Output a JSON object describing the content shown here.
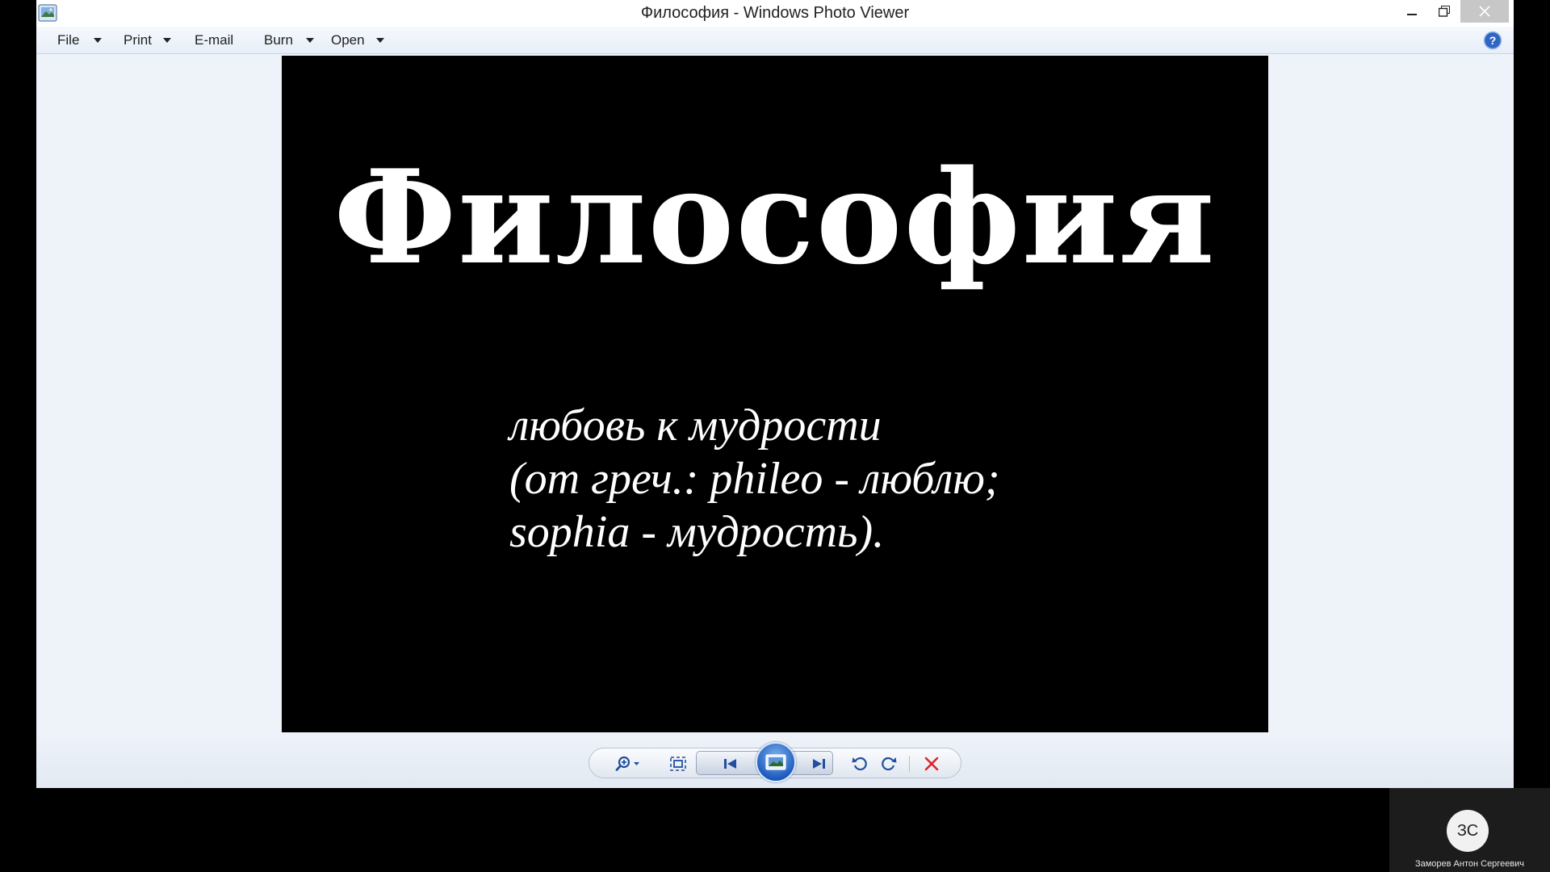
{
  "window": {
    "title": "Философия - Windows Photo Viewer"
  },
  "menu": {
    "file": "File",
    "print": "Print",
    "email": "E-mail",
    "burn": "Burn",
    "open": "Open"
  },
  "photo": {
    "title": "Философия",
    "lines": [
      "любовь к мудрости",
      "(от греч.: phileo - люблю;",
      "sophia - мудрость)."
    ]
  },
  "toolbar": {
    "icons": [
      "zoom-icon",
      "actual-size-icon",
      "previous-icon",
      "slideshow-icon",
      "next-icon",
      "rotate-counterclockwise-icon",
      "rotate-clockwise-icon",
      "delete-icon"
    ]
  },
  "participant": {
    "initials": "ЗС",
    "name": "Заморев Антон Сергеевич"
  },
  "colors": {
    "menubar": "#e7eef8",
    "background": "#eef3fa",
    "accent": "#1f5cbf",
    "delete": "#d9252b"
  }
}
